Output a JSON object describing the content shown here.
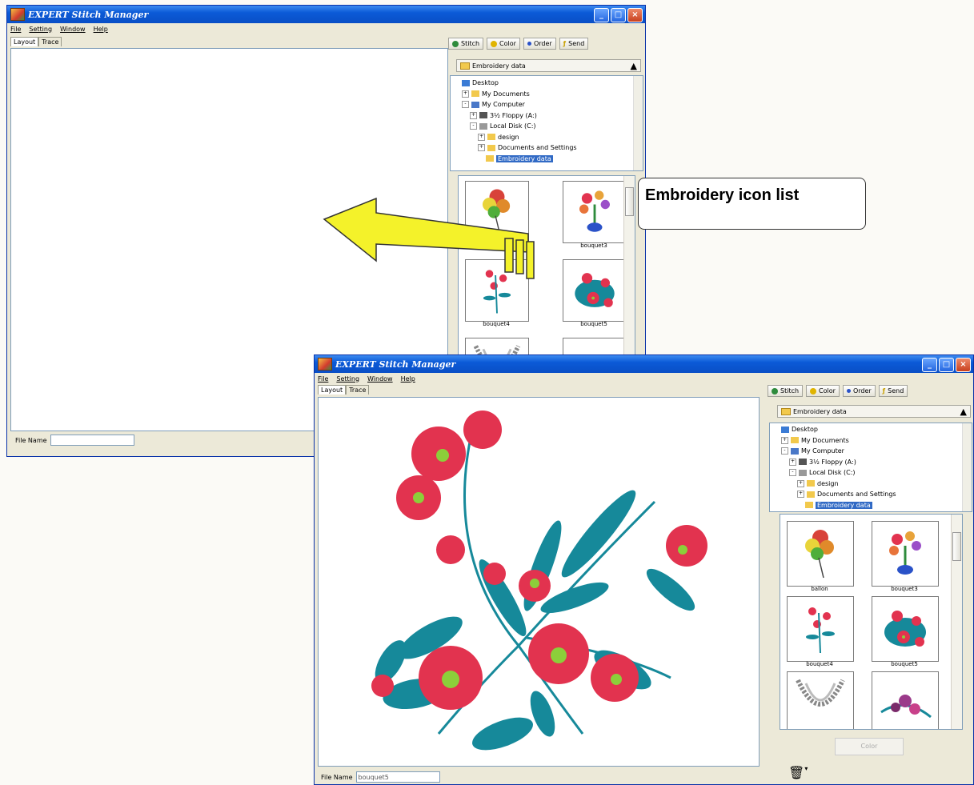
{
  "app": {
    "title": "EXPERT Stitch Manager",
    "menu": [
      "File",
      "Setting",
      "Window",
      "Help"
    ],
    "tabs": [
      "Layout",
      "Trace"
    ],
    "toolbar": [
      {
        "label": "Stitch",
        "icon": "stitch-icon",
        "color": "#2e8b3c"
      },
      {
        "label": "Color",
        "icon": "color-icon",
        "color": "#e0b400"
      },
      {
        "label": "Order",
        "icon": "order-icon",
        "color": "#2a52c8"
      },
      {
        "label": "Send",
        "icon": "send-icon",
        "color": "#c8a000"
      }
    ],
    "folder_bar": "Embroidery data",
    "file_name_label": "File Name",
    "window_buttons": [
      "_",
      "□",
      "×"
    ]
  },
  "tree": [
    {
      "label": "Desktop",
      "level": 0,
      "icon": "desktop-icon",
      "toggle": ""
    },
    {
      "label": "My Documents",
      "level": 1,
      "icon": "folder-icon",
      "toggle": "+"
    },
    {
      "label": "My Computer",
      "level": 1,
      "icon": "computer-icon",
      "toggle": "-"
    },
    {
      "label": "3½ Floppy (A:)",
      "level": 2,
      "icon": "floppy-icon",
      "toggle": "+"
    },
    {
      "label": "Local Disk (C:)",
      "level": 2,
      "icon": "disk-icon",
      "toggle": "-"
    },
    {
      "label": "design",
      "level": 3,
      "icon": "folder-icon",
      "toggle": "+"
    },
    {
      "label": "Documents and Settings",
      "level": 3,
      "icon": "folder-icon",
      "toggle": "+"
    },
    {
      "label": "Embroidery data",
      "level": 3,
      "icon": "folder-icon",
      "toggle": "",
      "selected": true
    }
  ],
  "window_before": {
    "file_name_value": "",
    "thumbnails": [
      {
        "name": "",
        "art": "balloon"
      },
      {
        "name": "bouquet3",
        "art": "bouquet3"
      },
      {
        "name": "bouquet4",
        "art": "bouquet4"
      },
      {
        "name": "bouquet5",
        "art": "bouquet5"
      },
      {
        "name": "",
        "art": "lace"
      },
      {
        "name": "",
        "art": "empty"
      }
    ]
  },
  "window_after": {
    "file_name_value": "bouquet5",
    "thumbnails": [
      {
        "name": "ballon",
        "art": "balloon"
      },
      {
        "name": "bouquet3",
        "art": "bouquet3"
      },
      {
        "name": "bouquet4",
        "art": "bouquet4"
      },
      {
        "name": "bouquet5",
        "art": "bouquet5"
      },
      {
        "name": "",
        "art": "lace"
      },
      {
        "name": "",
        "art": "flowerbranch"
      }
    ],
    "list_button": "Color",
    "trash_icon": "trash-icon"
  },
  "callout": {
    "text": "Embroidery icon list"
  },
  "colors": {
    "title_blue": "#0b5ad7",
    "xp_face": "#ece9d8",
    "arrow_yellow": "#f4f22a",
    "embroidery_red": "#e2334f",
    "embroidery_teal": "#16899a",
    "embroidery_green": "#8ccf3a"
  }
}
